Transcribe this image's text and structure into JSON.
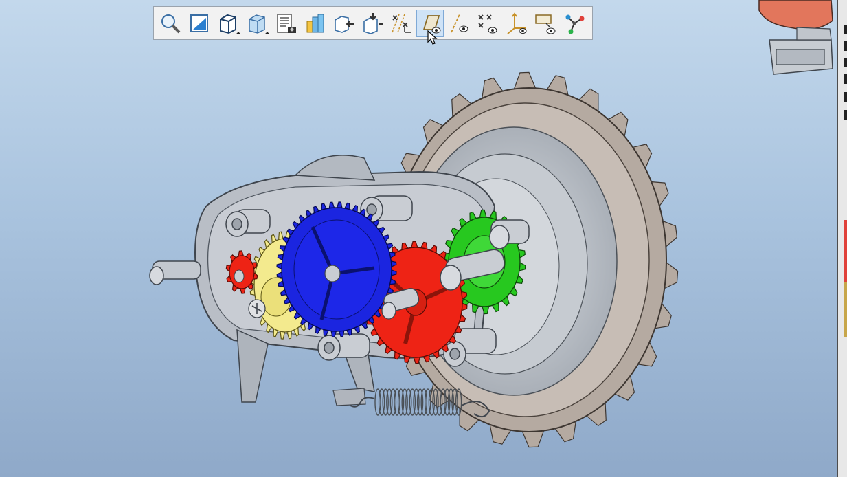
{
  "window": {
    "background_top": "#c3d8ec",
    "background_bottom": "#8fa9c9"
  },
  "toolbar": {
    "buttons": [
      {
        "name": "zoom-window-button",
        "icon": "magnifier-icon"
      },
      {
        "name": "orient-plane-button",
        "icon": "plane-normal-icon"
      },
      {
        "name": "display-style-button",
        "icon": "cube-shaded-icon"
      },
      {
        "name": "saved-views-button",
        "icon": "cube-view-list-icon"
      },
      {
        "name": "view-manager-button",
        "icon": "list-camera-icon"
      },
      {
        "name": "appearance-gallery-button",
        "icon": "color-palette-icon"
      },
      {
        "name": "annotation-display-button",
        "icon": "cube-arrow-icon"
      },
      {
        "name": "explode-view-button",
        "icon": "cube-explode-icon"
      },
      {
        "name": "datum-display-button",
        "icon": "axis-display-icon"
      },
      {
        "name": "plane-display-button",
        "icon": "plane-display-icon",
        "active": true
      },
      {
        "name": "axis-display-button",
        "icon": "axis-eye-icon"
      },
      {
        "name": "point-display-button",
        "icon": "point-eye-icon"
      },
      {
        "name": "csys-display-button",
        "icon": "csys-eye-icon"
      },
      {
        "name": "annotation-eye-button",
        "icon": "annotation-eye-icon"
      },
      {
        "name": "spin-center-button",
        "icon": "spin-center-icon"
      }
    ]
  },
  "model": {
    "colors": {
      "housing": "#b9bec6",
      "tire": "#b5aaa1",
      "gear_blue": "#1b25e0",
      "gear_red": "#ee2315",
      "gear_green": "#27c81f",
      "gear_yellow": "#f3ea8e",
      "steel": "#c8cccf"
    }
  }
}
